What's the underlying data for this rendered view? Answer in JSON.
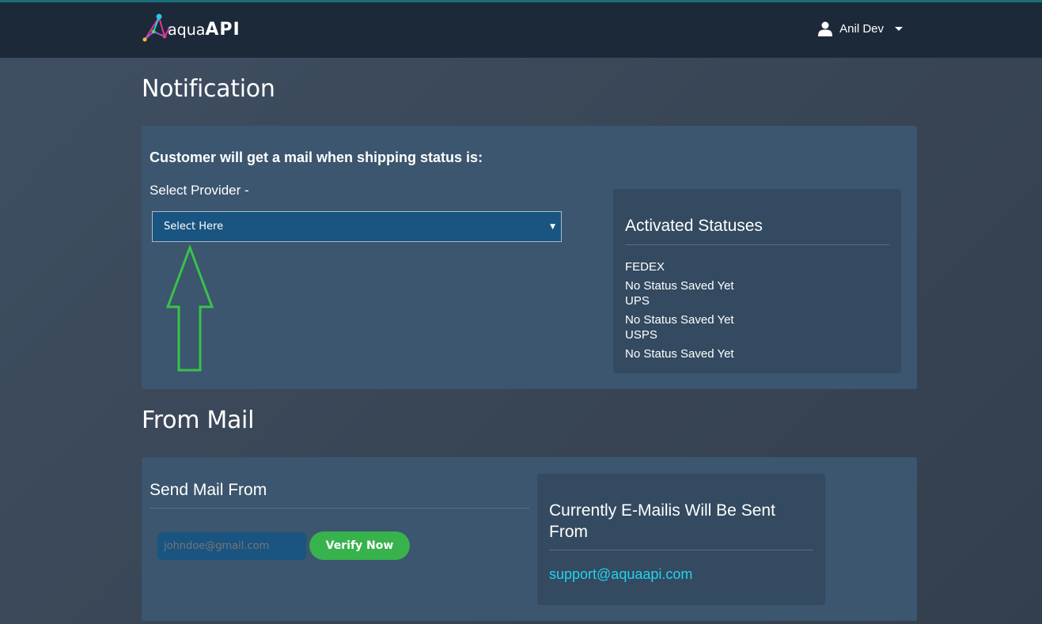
{
  "header": {
    "brand_small": "aqua",
    "brand_bold": "API",
    "user_name": "Anil Dev",
    "user_icon": "user-icon",
    "caret_icon": "caret-down-icon"
  },
  "notification": {
    "title": "Notification",
    "instruction": "Customer will get a mail when shipping status is:",
    "provider_label": "Select Provider -",
    "select_value": "Select Here",
    "activated": {
      "title": "Activated Statuses",
      "entries": [
        {
          "provider": "FEDEX",
          "status": "No Status Saved Yet"
        },
        {
          "provider": "UPS",
          "status": "No Status Saved Yet"
        },
        {
          "provider": "USPS",
          "status": "No Status Saved Yet"
        }
      ]
    }
  },
  "from_mail": {
    "title": "From Mail",
    "send_title": "Send Mail From",
    "email_placeholder": "johndoe@gmail.com",
    "verify_label": "Verify Now",
    "current": {
      "title": "Currently E-Mailis Will Be Sent From",
      "email": "support@aquaapi.com"
    }
  },
  "colors": {
    "accent_green": "#37b24d",
    "link_cyan": "#22d3ee",
    "navbar": "#1c2938",
    "panel": "#3b566e"
  }
}
